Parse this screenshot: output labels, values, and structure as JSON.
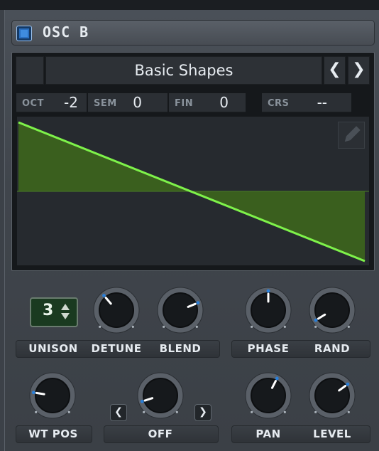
{
  "header": {
    "title": "OSC B",
    "enabled": true
  },
  "wavetable": {
    "name": "Basic Shapes",
    "prev_icon": "chevron-left-icon",
    "next_icon": "chevron-right-icon",
    "edit_icon": "pencil-icon"
  },
  "tuning": [
    {
      "label": "OCT",
      "value": "-2"
    },
    {
      "label": "SEM",
      "value": "0"
    },
    {
      "label": "FIN",
      "value": "0"
    },
    {
      "label": "CRS",
      "value": "--"
    }
  ],
  "controls": {
    "unison": {
      "label": "UNISON",
      "value": "3"
    },
    "detune": {
      "label": "DETUNE",
      "level": 0.35
    },
    "blend": {
      "label": "BLEND",
      "level": 0.75
    },
    "phase": {
      "label": "PHASE",
      "level": 0.5
    },
    "rand": {
      "label": "RAND",
      "level": 0.05
    },
    "wt_pos": {
      "label": "WT POS",
      "level": 0.2
    },
    "off_knob": {
      "label": "OFF",
      "level": 0.1
    },
    "pan": {
      "label": "PAN",
      "level": 0.6
    },
    "level": {
      "label": "LEVEL",
      "level": 0.7
    }
  },
  "colors": {
    "accent": "#2a7fd9",
    "wave_line": "#7ef24a",
    "wave_fill": "#3f6b20"
  }
}
